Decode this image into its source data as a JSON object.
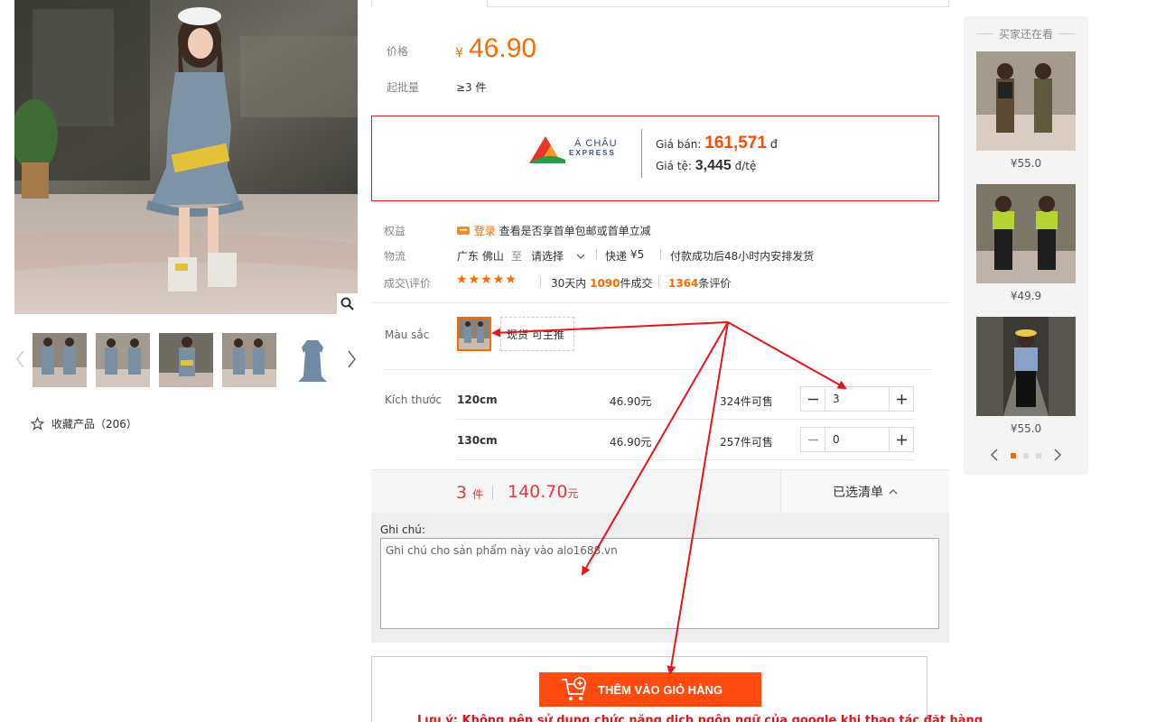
{
  "gallery": {
    "favorite_label": "收藏产品（206）"
  },
  "product": {
    "price_label": "价格",
    "price_currency": "¥",
    "price_value": "46.90",
    "moq_label": "起批量",
    "moq_value": "≥3 件"
  },
  "express": {
    "logo_text": "Á CHÂU",
    "logo_sub": "EXPRESS",
    "sale_label": "Giá bán:",
    "sale_value": "161,571",
    "sale_unit": "đ",
    "rate_label": "Giá tệ:",
    "rate_value": "3,445",
    "rate_unit": "đ/tệ"
  },
  "rights": {
    "label": "权益",
    "login_link": "登录",
    "text": "查看是否享首单包邮或首单立减"
  },
  "shipping": {
    "label": "物流",
    "from": "广东 佛山",
    "to_word": "至",
    "select": "请选择",
    "method": "快递",
    "fee": "¥5",
    "note": "付款成功后48小时内安排发货"
  },
  "reviews": {
    "label": "成交\\评价",
    "stars": "★★★★★",
    "deals_prefix": "30天内",
    "deals_count": "1090",
    "deals_suffix": "件成交",
    "review_count": "1364",
    "review_suffix": "条评价"
  },
  "color": {
    "label": "Màu sắc",
    "option_text": "现货 可主推"
  },
  "sizes": {
    "label": "Kích thước",
    "rows": [
      {
        "name": "120cm",
        "price": "46.90元",
        "stock": "324件可售",
        "qty": "3"
      },
      {
        "name": "130cm",
        "price": "46.90元",
        "stock": "257件可售",
        "qty": "0"
      }
    ]
  },
  "summary": {
    "count": "3",
    "count_unit": "件",
    "total": "140.70",
    "total_unit": "元",
    "list_label": "已选清单"
  },
  "note": {
    "label": "Ghi chú:",
    "placeholder": "Ghi chú cho sản phẩm này vào alo1688.vn"
  },
  "cart": {
    "button_label": "THÊM VÀO GIỎ HÀNG",
    "warning": "Lưu ý: Không nên sử dụng chức năng dịch ngôn ngữ của google khi thao tác đặt hàng"
  },
  "recommend": {
    "title": "买家还在看",
    "items": [
      {
        "price": "¥55.0"
      },
      {
        "price": "¥49.9"
      },
      {
        "price": "¥55.0"
      }
    ]
  },
  "colors": {
    "accent_orange": "#ff6a00",
    "price_red": "#e4393c",
    "cart_button": "#ff4b0f",
    "arrow_red": "#e8141b"
  }
}
